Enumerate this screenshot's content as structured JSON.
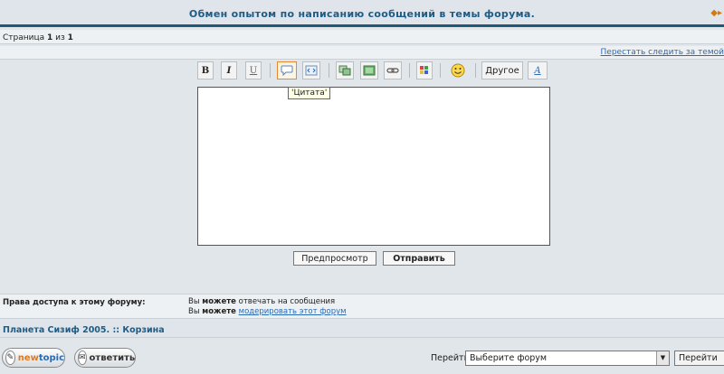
{
  "topic": {
    "title": "Обмен опытом по написанию сообщений в темы форума."
  },
  "pager": {
    "prefix": "Страница",
    "current": "1",
    "sep": "из",
    "total": "1"
  },
  "watch": {
    "unwatch_link": "Перестать следить за темой"
  },
  "toolbar": {
    "bold": "B",
    "italic": "I",
    "underline": "U",
    "other": "Другое",
    "font": "A",
    "icons": [
      "bold-icon",
      "italic-icon",
      "underline-icon",
      "quote-icon",
      "code-icon",
      "image-icon",
      "picture-icon",
      "link-icon",
      "color-icon",
      "smiley-icon",
      "other-icon",
      "font-icon"
    ]
  },
  "tooltip": {
    "text": "'Цитата'"
  },
  "editor": {
    "value": ""
  },
  "actions": {
    "preview": "Предпросмотр",
    "submit": "Отправить"
  },
  "permissions": {
    "label": "Права доступа к этому форуму:",
    "line1_prefix": "Вы",
    "line1_bold": "можете",
    "line1_rest": "отвечать на сообщения",
    "line2_prefix": "Вы",
    "line2_bold": "можете",
    "line2_link": "модерировать этот форум"
  },
  "breadcrumb": {
    "site": "Планета Сизиф 2005.",
    "sep": "::",
    "section": "Корзина"
  },
  "bottom": {
    "newtopic_a": "new",
    "newtopic_b": "topic",
    "reply": "ответить",
    "jump_label": "Перейти:",
    "jump_selected": "Выберите форум",
    "jump_button": "Перейти"
  },
  "colors": {
    "accent": "#1e5a78",
    "link": "#2a6ab3",
    "title": "#1d5c87",
    "highlight": "#e6892e"
  }
}
